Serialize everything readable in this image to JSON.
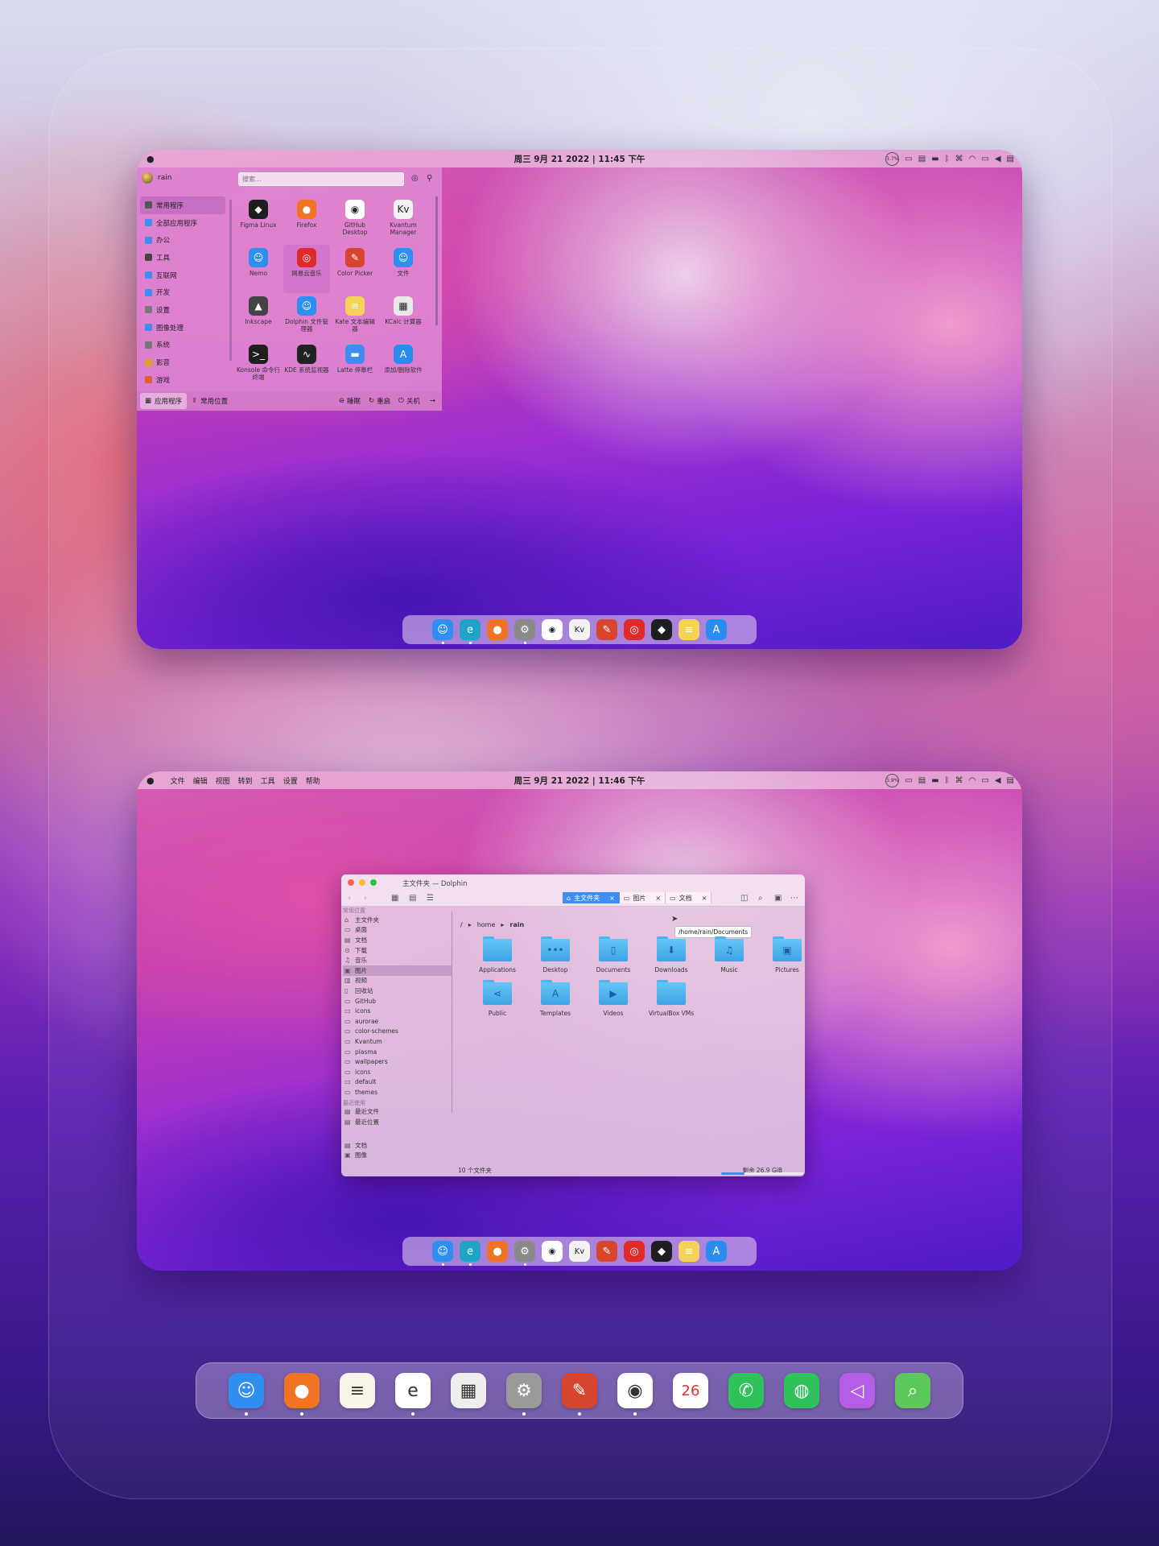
{
  "screen1": {
    "menubar": {
      "clock": "周三 9月 21 2022 | 11:45 下午",
      "cpu": "3.7%"
    },
    "launcher": {
      "user": "rain",
      "search_placeholder": "搜索...",
      "categories": [
        {
          "label": "常用程序",
          "icon": "bookmark-icon"
        },
        {
          "label": "全部应用程序",
          "icon": "grid-icon"
        },
        {
          "label": "办公",
          "icon": "office-icon"
        },
        {
          "label": "工具",
          "icon": "tools-icon"
        },
        {
          "label": "互联网",
          "icon": "globe-icon"
        },
        {
          "label": "开发",
          "icon": "dev-icon"
        },
        {
          "label": "设置",
          "icon": "settings-icon"
        },
        {
          "label": "图像处理",
          "icon": "image-icon"
        },
        {
          "label": "系统",
          "icon": "system-icon"
        },
        {
          "label": "影音",
          "icon": "music-icon"
        },
        {
          "label": "游戏",
          "icon": "game-icon"
        }
      ],
      "apps": [
        {
          "label": "Figma Linux",
          "icon": "figma-icon",
          "color": "#1e1e1e",
          "glyph": "◆"
        },
        {
          "label": "Firefox",
          "icon": "firefox-icon",
          "color": "#f07424",
          "glyph": "●"
        },
        {
          "label": "GitHub Desktop",
          "icon": "github-icon",
          "color": "#ffffff",
          "glyph": "◉"
        },
        {
          "label": "Kvantum Manager",
          "icon": "kvantum-icon",
          "color": "#f2f2f2",
          "glyph": "Kv"
        },
        {
          "label": "Nemo",
          "icon": "finder-icon",
          "color": "#2e8ff0",
          "glyph": "☺"
        },
        {
          "label": "网易云音乐",
          "icon": "netease-music-icon",
          "color": "#e02a2a",
          "glyph": "◎"
        },
        {
          "label": "Color Picker",
          "icon": "color-picker-icon",
          "color": "#d8452e",
          "glyph": "✎"
        },
        {
          "label": "文件",
          "icon": "files-icon",
          "color": "#2e8ff0",
          "glyph": "☺"
        },
        {
          "label": "Inkscape",
          "icon": "inkscape-icon",
          "color": "#444444",
          "glyph": "▲"
        },
        {
          "label": "Dolphin 文件管理器",
          "icon": "dolphin-icon",
          "color": "#2e8ff0",
          "glyph": "☺"
        },
        {
          "label": "Kate 文本编辑器",
          "icon": "kate-icon",
          "color": "#f6d25a",
          "glyph": "≡"
        },
        {
          "label": "KCalc 计算器",
          "icon": "calculator-icon",
          "color": "#e8e8e8",
          "glyph": "▦"
        },
        {
          "label": "Konsole 命令行终端",
          "icon": "terminal-icon",
          "color": "#1f1f1f",
          "glyph": ">_"
        },
        {
          "label": "KDE 系统监视器",
          "icon": "monitor-icon",
          "color": "#222222",
          "glyph": "∿"
        },
        {
          "label": "Latte 停靠栏",
          "icon": "latte-icon",
          "color": "#3d8ef0",
          "glyph": "▬"
        },
        {
          "label": "添加/删除软件",
          "icon": "appstore-icon",
          "color": "#2b8cf0",
          "glyph": "A"
        }
      ],
      "footer": {
        "apps_tab": "应用程序",
        "places_tab": "常用位置",
        "sleep": "睡眠",
        "restart": "重启",
        "shutdown": "关机"
      }
    }
  },
  "screen2": {
    "menubar": {
      "clock": "周三 9月 21 2022 | 11:46 下午",
      "cpu": "3.9%",
      "menus": [
        "文件",
        "编辑",
        "视图",
        "转到",
        "工具",
        "设置",
        "帮助"
      ]
    },
    "dolphin": {
      "title": "主文件夹 — Dolphin",
      "tabs": [
        {
          "label": "主文件夹",
          "icon": "home-icon"
        },
        {
          "label": "图片",
          "icon": "folder-icon"
        },
        {
          "label": "文档",
          "icon": "folder-icon"
        }
      ],
      "places_group": "常用位置",
      "places": [
        {
          "label": "主文件夹",
          "icon": "⌂"
        },
        {
          "label": "桌面",
          "icon": "▭"
        },
        {
          "label": "文档",
          "icon": "▤"
        },
        {
          "label": "下载",
          "icon": "⊙"
        },
        {
          "label": "音乐",
          "icon": "♫"
        },
        {
          "label": "图片",
          "icon": "▣"
        },
        {
          "label": "视频",
          "icon": "▥"
        },
        {
          "label": "回收站",
          "icon": "▯"
        },
        {
          "label": "GitHub",
          "icon": "▭"
        },
        {
          "label": "icons",
          "icon": "▭"
        },
        {
          "label": "aurorae",
          "icon": "▭"
        },
        {
          "label": "color-schemes",
          "icon": "▭"
        },
        {
          "label": "Kvantum",
          "icon": "▭"
        },
        {
          "label": "plasma",
          "icon": "▭"
        },
        {
          "label": "wallpapers",
          "icon": "▭"
        },
        {
          "label": "icons",
          "icon": "▭"
        },
        {
          "label": "default",
          "icon": "▭"
        },
        {
          "label": "themes",
          "icon": "▭"
        }
      ],
      "recent_group": "最近使用",
      "recent": [
        {
          "label": "最近文件",
          "icon": "▤"
        },
        {
          "label": "最近位置",
          "icon": "▤"
        }
      ],
      "search_places": [
        {
          "label": "文档",
          "icon": "▤"
        },
        {
          "label": "图像",
          "icon": "▣"
        }
      ],
      "breadcrumb": [
        "/",
        "home",
        "rain"
      ],
      "tooltip": "/home/rain/Documents",
      "files": [
        {
          "label": "Applications",
          "glyph": ""
        },
        {
          "label": "Desktop",
          "glyph": "•••"
        },
        {
          "label": "Documents",
          "glyph": "▯"
        },
        {
          "label": "Downloads",
          "glyph": "⬇"
        },
        {
          "label": "Music",
          "glyph": "♫"
        },
        {
          "label": "Pictures",
          "glyph": "▣"
        },
        {
          "label": "Public",
          "glyph": "⋖"
        },
        {
          "label": "Templates",
          "glyph": "A"
        },
        {
          "label": "Videos",
          "glyph": "▶"
        },
        {
          "label": "VirtualBox VMs",
          "glyph": ""
        }
      ],
      "status": "10 个文件夹",
      "free_space": "剩余 26.9 GiB",
      "free_fraction": 0.28
    }
  },
  "mini_dock": [
    {
      "name": "finder",
      "color": "#2e8ff0",
      "glyph": "☺",
      "running": true
    },
    {
      "name": "edge",
      "color": "#1fa3c6",
      "glyph": "e",
      "running": true
    },
    {
      "name": "firefox",
      "color": "#f07424",
      "glyph": "●",
      "running": false
    },
    {
      "name": "system-settings",
      "color": "#8a8a8a",
      "glyph": "⚙",
      "running": true
    },
    {
      "name": "github",
      "color": "#ffffff",
      "glyph": "◉",
      "running": false
    },
    {
      "name": "kvantum",
      "color": "#f2f2f2",
      "glyph": "Kv",
      "running": false
    },
    {
      "name": "color-picker",
      "color": "#d8452e",
      "glyph": "✎",
      "running": false
    },
    {
      "name": "netease-music",
      "color": "#e02a2a",
      "glyph": "◎",
      "running": false
    },
    {
      "name": "figma",
      "color": "#1e1e1e",
      "glyph": "◆",
      "running": false
    },
    {
      "name": "notes",
      "color": "#f6d25a",
      "glyph": "≡",
      "running": false
    },
    {
      "name": "appstore",
      "color": "#2b8cf0",
      "glyph": "A",
      "running": false
    }
  ],
  "big_dock": [
    {
      "name": "finder",
      "color": "#2e8ff0",
      "glyph": "☺",
      "running": true
    },
    {
      "name": "firefox",
      "color": "#f07424",
      "glyph": "●",
      "running": true
    },
    {
      "name": "notes",
      "color": "#f8f4e6",
      "glyph": "≡",
      "running": false
    },
    {
      "name": "edge-dev",
      "color": "#ffffff",
      "glyph": "e",
      "running": true
    },
    {
      "name": "calculator",
      "color": "#eeeeee",
      "glyph": "▦",
      "running": false
    },
    {
      "name": "system-settings",
      "color": "#9a9a9a",
      "glyph": "⚙",
      "running": true
    },
    {
      "name": "color-picker",
      "color": "#d8452e",
      "glyph": "✎",
      "running": true
    },
    {
      "name": "github",
      "color": "#ffffff",
      "glyph": "◉",
      "running": true
    },
    {
      "name": "calendar",
      "color": "#ffffff",
      "glyph": "26",
      "running": false
    },
    {
      "name": "whatsapp",
      "color": "#2fc25a",
      "glyph": "✆",
      "running": false
    },
    {
      "name": "wechat",
      "color": "#2fc25a",
      "glyph": "◍",
      "running": false
    },
    {
      "name": "vs-code-insiders",
      "color": "#b45ee8",
      "glyph": "◁",
      "running": false
    },
    {
      "name": "search",
      "color": "#5cc85a",
      "glyph": "⌕",
      "running": false
    }
  ]
}
